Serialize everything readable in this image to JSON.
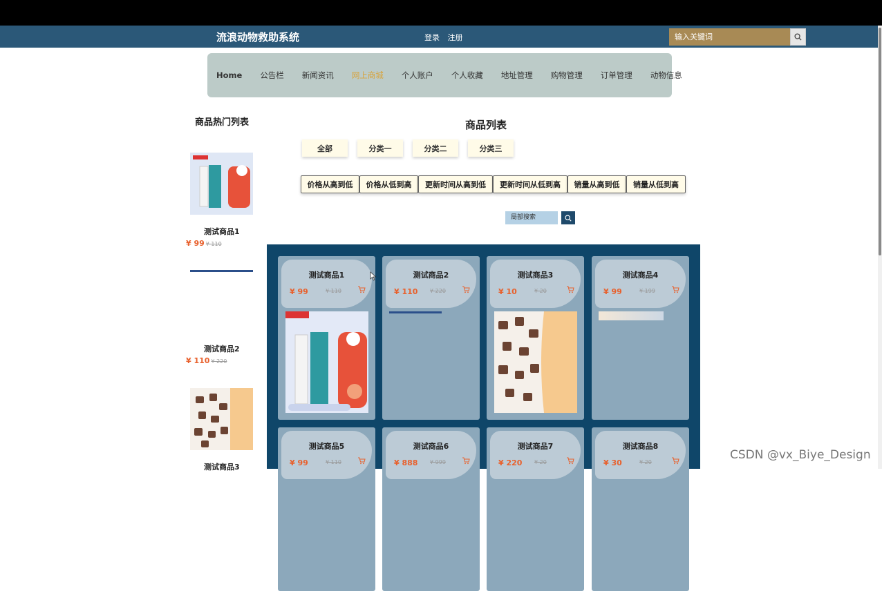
{
  "header": {
    "site_title": "流浪动物救助系统",
    "login": "登录",
    "register": "注册",
    "search_placeholder": "输入关键词"
  },
  "nav": {
    "items": [
      "Home",
      "公告栏",
      "新闻资讯",
      "网上商城",
      "个人账户",
      "个人收藏",
      "地址管理",
      "购物管理",
      "订单管理",
      "动物信息"
    ],
    "active": "网上商城"
  },
  "hot": {
    "title": "商品热门列表",
    "items": [
      {
        "name": "测试商品1",
        "price": "¥ 99",
        "old_price": "¥ 110"
      },
      {
        "name": "测试商品2",
        "price": "¥ 110",
        "old_price": "¥ 220"
      },
      {
        "name": "测试商品3"
      }
    ]
  },
  "main": {
    "title": "商品列表",
    "categories": [
      "全部",
      "分类一",
      "分类二",
      "分类三"
    ],
    "sorts": [
      "价格从高到低",
      "价格从低到高",
      "更新时间从高到低",
      "更新时间从低到高",
      "销量从高到低",
      "销量从低到高"
    ],
    "local_search_placeholder": "局部搜索",
    "products": [
      {
        "name": "测试商品1",
        "price": "¥ 99",
        "old_price": "¥ 110"
      },
      {
        "name": "测试商品2",
        "price": "¥ 110",
        "old_price": "¥ 220"
      },
      {
        "name": "测试商品3",
        "price": "¥ 10",
        "old_price": "¥ 20"
      },
      {
        "name": "测试商品4",
        "price": "¥ 99",
        "old_price": "¥ 199"
      },
      {
        "name": "测试商品5",
        "price": "¥ 99",
        "old_price": "¥ 110"
      },
      {
        "name": "测试商品6",
        "price": "¥ 888",
        "old_price": "¥ 999"
      },
      {
        "name": "测试商品7",
        "price": "¥ 220",
        "old_price": "¥ 20"
      },
      {
        "name": "测试商品8",
        "price": "¥ 30",
        "old_price": "¥ 20"
      }
    ]
  },
  "watermark": "CSDN @vx_Biye_Design",
  "icons": {
    "search": "search-icon",
    "cart": "cart-icon"
  },
  "colors": {
    "topbar": "#2b5878",
    "nav": "#bccbc8",
    "active": "#d8a33a",
    "price": "#e8602c",
    "grid_bg": "#0f4669"
  }
}
